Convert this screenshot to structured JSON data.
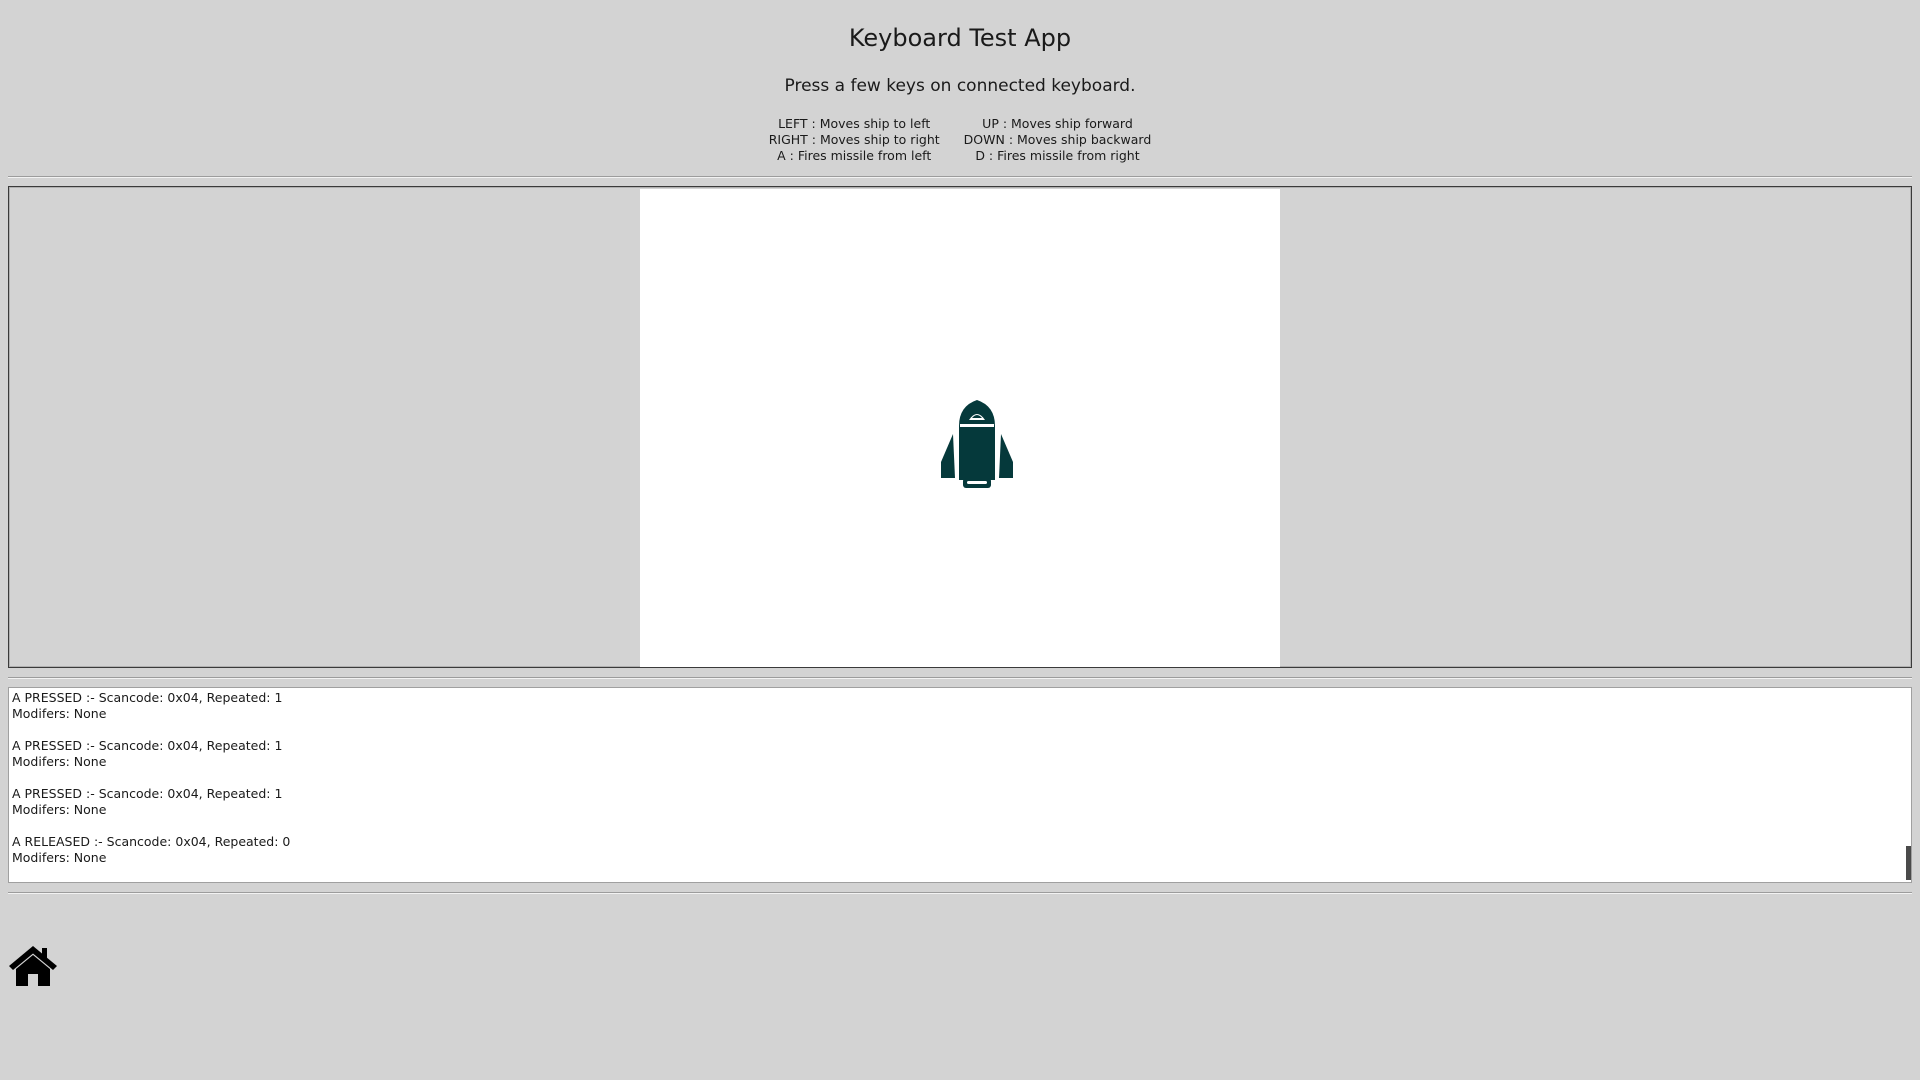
{
  "header": {
    "title": "Keyboard Test App",
    "instructions": "Press a few keys on connected keyboard."
  },
  "controls": {
    "left": [
      "LEFT : Moves ship to left",
      "RIGHT : Moves ship to right",
      "A : Fires missile from left"
    ],
    "right": [
      "UP : Moves ship forward",
      "DOWN : Moves ship backward",
      "D : Fires missile from right"
    ]
  },
  "game": {
    "ship_icon": "rocket-ship-icon",
    "ship_color": "#05393b",
    "canvas_color": "#ffffff"
  },
  "log": {
    "entries": [
      {
        "event": "A PRESSED :- Scancode: 0x04, Repeated: 1",
        "modifiers": "Modifers: None"
      },
      {
        "event": "A PRESSED :- Scancode: 0x04, Repeated: 1",
        "modifiers": "Modifers: None"
      },
      {
        "event": "A PRESSED :- Scancode: 0x04, Repeated: 1",
        "modifiers": "Modifers: None"
      },
      {
        "event": "A RELEASED :- Scancode: 0x04, Repeated: 0",
        "modifiers": "Modifers: None"
      }
    ]
  },
  "footer": {
    "home_icon": "home-icon"
  },
  "colors": {
    "background": "#d3d3d3",
    "ship": "#05393b"
  }
}
